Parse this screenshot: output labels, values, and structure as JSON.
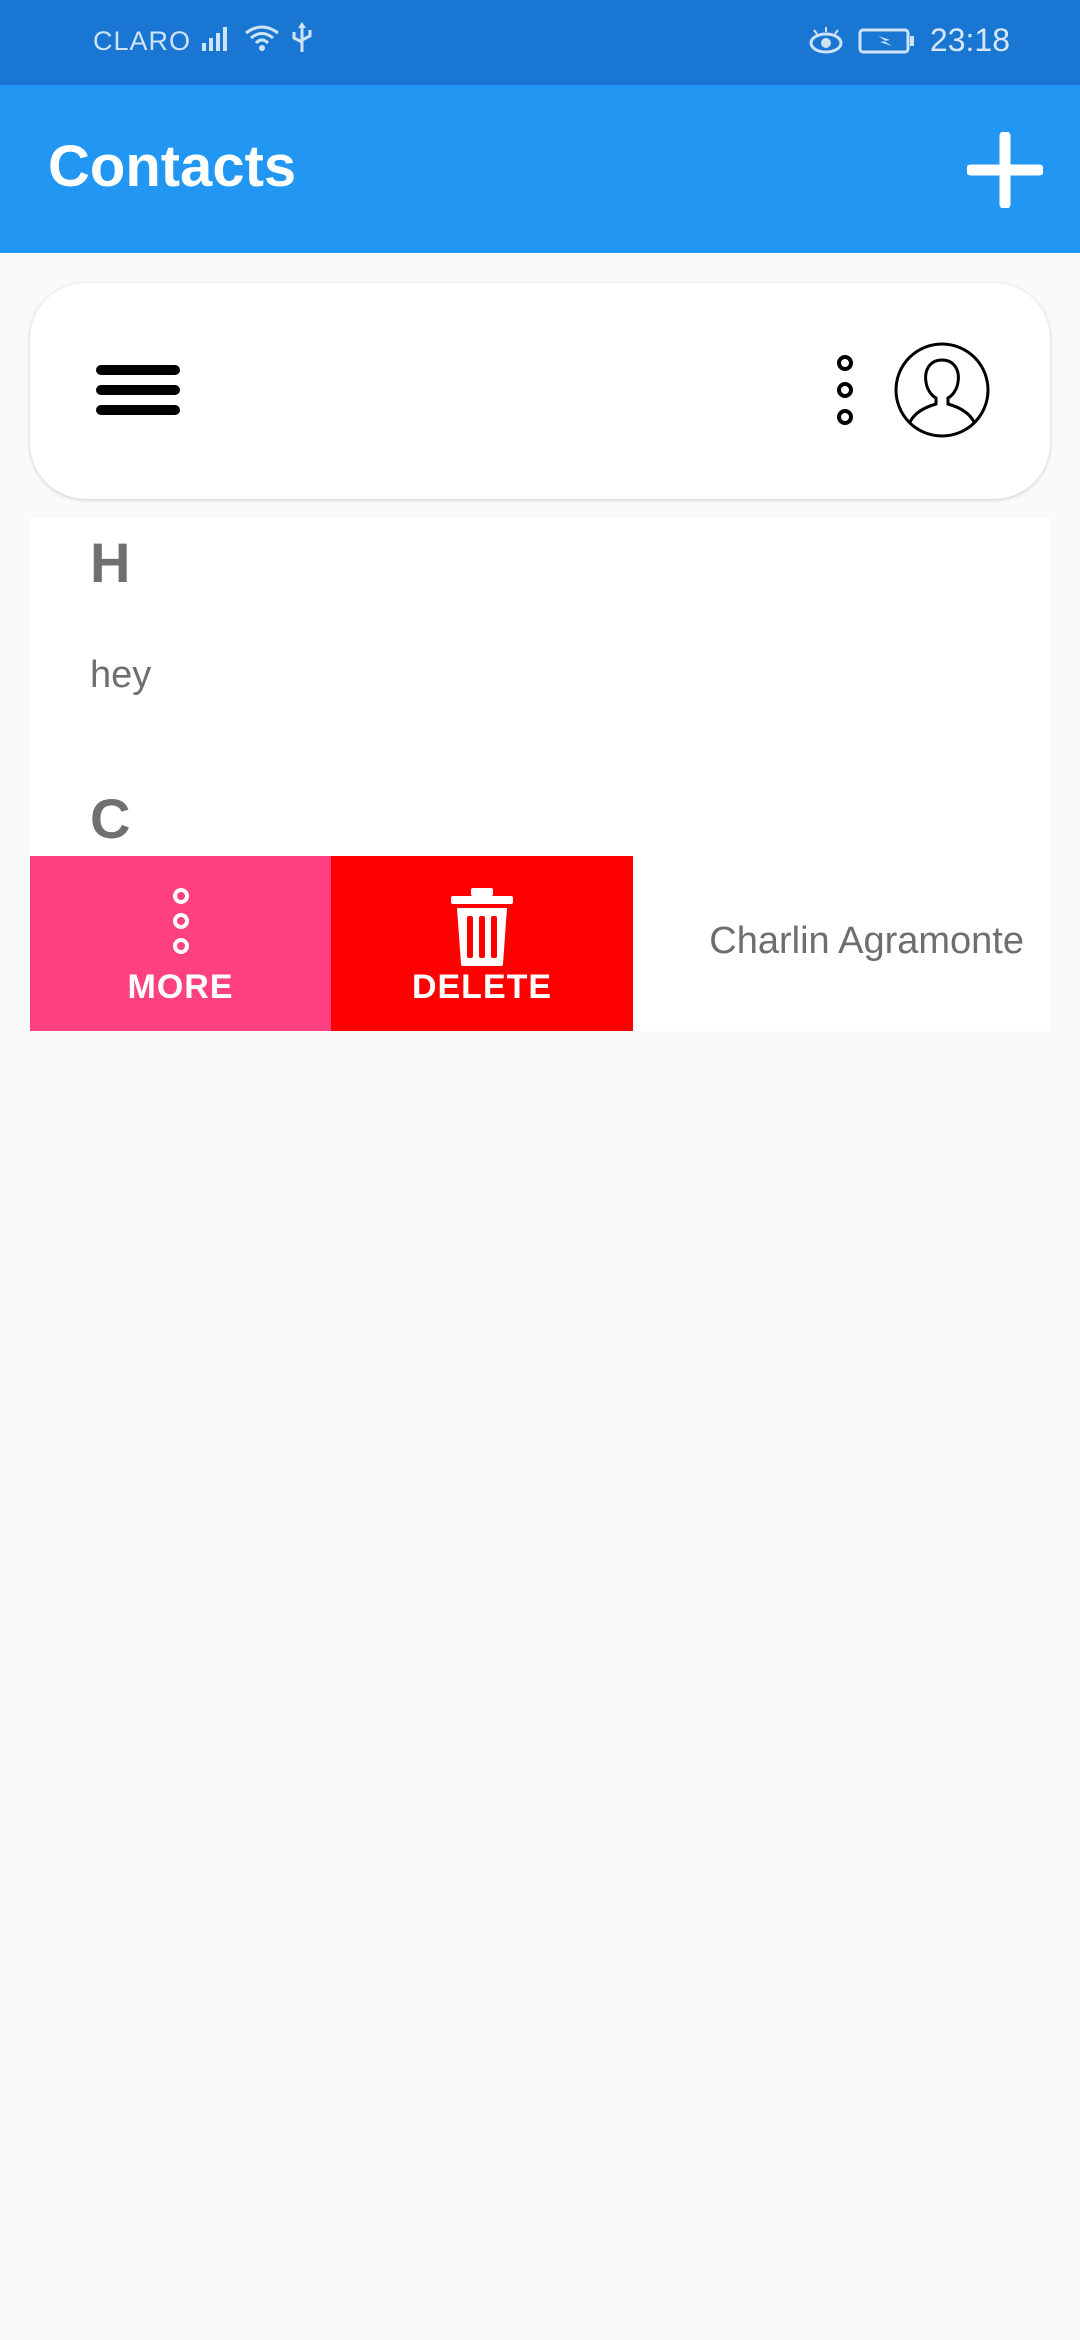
{
  "status_bar": {
    "carrier": "CLARO",
    "time": "23:18",
    "left_icons": [
      "signal-icon",
      "wifi-icon",
      "usb-icon"
    ],
    "right_icons": [
      "eye-icon",
      "battery-charging-icon"
    ]
  },
  "app_bar": {
    "title": "Contacts",
    "add_icon": "plus-icon",
    "background": "#2196f3"
  },
  "search_bar": {
    "menu_icon": "hamburger-menu-icon",
    "more_icon": "vertical-dots-icon",
    "avatar_icon": "user-avatar-icon"
  },
  "sections": [
    {
      "letter": "H",
      "contacts": [
        {
          "name": "hey"
        }
      ]
    },
    {
      "letter": "C",
      "contacts": [
        {
          "name": "Charlin Agramonte",
          "swiped": true,
          "actions": [
            {
              "label": "MORE",
              "icon": "vertical-dots-icon",
              "color": "#ff4081"
            },
            {
              "label": "DELETE",
              "icon": "trash-icon",
              "color": "#ff0000"
            }
          ]
        }
      ]
    }
  ]
}
